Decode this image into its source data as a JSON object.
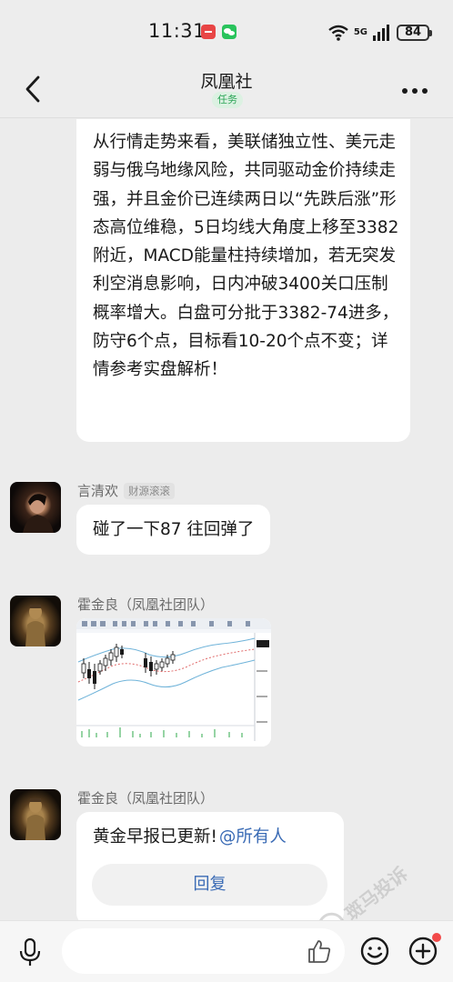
{
  "status_bar": {
    "time": "11:31",
    "network": "5G",
    "battery": "84"
  },
  "header": {
    "title": "凤凰社",
    "badge": "任务"
  },
  "messages": [
    {
      "type": "text",
      "text": "从行情走势来看，美联储独立性、美元走弱与俄乌地缘风险，共同驱动金价持续走强，并且金价已连续两日以“先跌后涨”形态高位维稳，5日均线大角度上移至3382附近，MACD能量柱持续增加，若无突发利空消息影响，日内冲破3400关口压制概率增大。白盘可分批于3382-74进多，防守6个点，目标看10-20个点不变；详情参考实盘解析！"
    },
    {
      "type": "text",
      "sender": "言清欢",
      "sender_tag": "财源滚滚",
      "text": "碰了一下87 往回弹了"
    },
    {
      "type": "image",
      "sender": "霍金良（凤凰社团队）",
      "image_desc": "chart-screenshot"
    },
    {
      "type": "notice",
      "sender": "霍金良（凤凰社团队）",
      "text": "黄金早报已更新!",
      "mention": "@所有人",
      "reply_label": "回复"
    }
  ],
  "watermark": "斑马投诉",
  "input": {
    "placeholder": ""
  },
  "colors": {
    "background": "#ececec",
    "bubble": "#ffffff",
    "link": "#3a6bb5",
    "badge_bg": "#dcf1e2",
    "badge_text": "#2aa456",
    "notify_dot": "#f24a4a"
  }
}
